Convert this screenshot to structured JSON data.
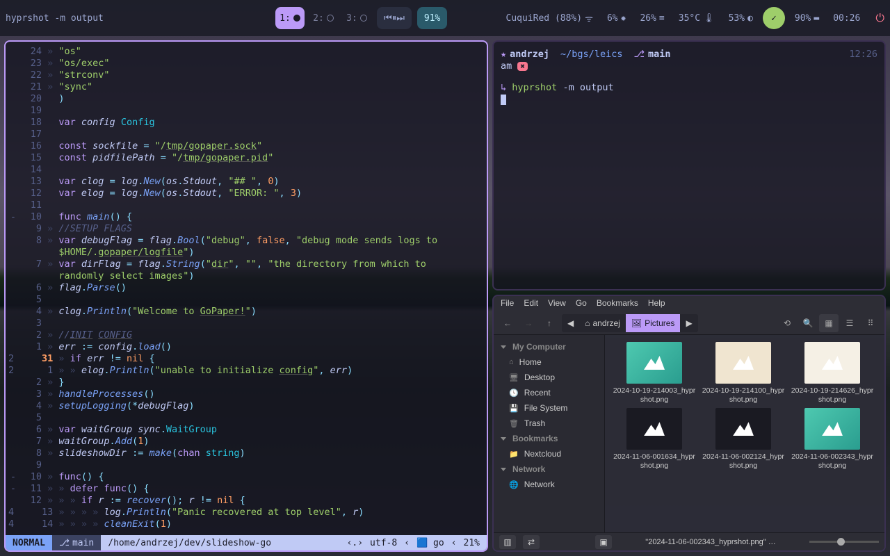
{
  "bar": {
    "command": "hyprshot -m output",
    "workspaces": [
      {
        "label": "1:",
        "active": true
      },
      {
        "label": "2:",
        "active": false
      },
      {
        "label": "3:",
        "active": false
      }
    ],
    "updates_pct": "91%",
    "wifi": "CuquiRed (88%)",
    "cpu": "6%",
    "mem": "26%",
    "temp": "35°C",
    "disk": "53%",
    "battery": "90%",
    "clock": "00:26"
  },
  "editor": {
    "lines": [
      {
        "n": "24",
        "g": "»",
        "html": "<span class='str'>\"os\"</span>"
      },
      {
        "n": "23",
        "g": "»",
        "html": "<span class='str'>\"os/exec\"</span>"
      },
      {
        "n": "22",
        "g": "»",
        "html": "<span class='str'>\"strconv\"</span>"
      },
      {
        "n": "21",
        "g": "»",
        "html": "<span class='str'>\"sync\"</span>"
      },
      {
        "n": "20",
        "g": " ",
        "html": "<span class='punc'>)</span>"
      },
      {
        "n": "19",
        "g": " ",
        "html": ""
      },
      {
        "n": "18",
        "g": " ",
        "html": "<span class='kw'>var</span> <span class='id'>config</span> <span class='typ'>Config</span>"
      },
      {
        "n": "17",
        "g": " ",
        "html": ""
      },
      {
        "n": "16",
        "g": " ",
        "html": "<span class='kw'>const</span> <span class='id'>sockfile</span> <span class='op'>=</span> <span class='str'>\"/<span class='underline'>tmp/gopaper.sock</span>\"</span>"
      },
      {
        "n": "15",
        "g": " ",
        "html": "<span class='kw'>const</span> <span class='id'>pidfilePath</span> <span class='op'>=</span> <span class='str'>\"/<span class='underline'>tmp/gopaper.pid</span>\"</span>"
      },
      {
        "n": "14",
        "g": " ",
        "html": ""
      },
      {
        "n": "13",
        "g": " ",
        "html": "<span class='kw'>var</span> <span class='id'>clog</span> <span class='op'>=</span> <span class='id'>log</span><span class='punc'>.</span><span class='fn'>New</span><span class='punc'>(</span><span class='id'>os</span><span class='punc'>.</span><span class='id'>Stdout</span><span class='punc'>,</span> <span class='str'>\"## \"</span><span class='punc'>,</span> <span class='num'>0</span><span class='punc'>)</span>"
      },
      {
        "n": "12",
        "g": " ",
        "html": "<span class='kw'>var</span> <span class='id'>elog</span> <span class='op'>=</span> <span class='id'>log</span><span class='punc'>.</span><span class='fn'>New</span><span class='punc'>(</span><span class='id'>os</span><span class='punc'>.</span><span class='id'>Stdout</span><span class='punc'>,</span> <span class='str'>\"ERROR: \"</span><span class='punc'>,</span> <span class='num'>3</span><span class='punc'>)</span>"
      },
      {
        "n": "11",
        "g": " ",
        "html": ""
      },
      {
        "n": "10",
        "g": " ",
        "fold": "-",
        "html": "<span class='kw'>func</span> <span class='fn'>main</span><span class='punc'>()</span> <span class='punc'>{</span>"
      },
      {
        "n": "9",
        "g": "»",
        "html": "<span class='com'>//SETUP FLAGS</span>"
      },
      {
        "n": "8",
        "g": "»",
        "html": "<span class='kw'>var</span> <span class='id'>debugFlag</span> <span class='op'>=</span> <span class='id'>flag</span><span class='punc'>.</span><span class='fn'>Bool</span><span class='punc'>(</span><span class='str'>\"debug\"</span><span class='punc'>,</span> <span class='nil'>false</span><span class='punc'>,</span> <span class='str'>\"debug mode sends logs to</span>"
      },
      {
        "n": "",
        "g": " ",
        "html": "<span class='str'>$HOME/.<span class='underline'>gopaper/logfile</span>\"</span><span class='punc'>)</span>"
      },
      {
        "n": "7",
        "g": "»",
        "html": "<span class='kw'>var</span> <span class='id'>dirFlag</span> <span class='op'>=</span> <span class='id'>flag</span><span class='punc'>.</span><span class='fn'>String</span><span class='punc'>(</span><span class='str'>\"<span class='underline'>dir</span>\"</span><span class='punc'>,</span> <span class='str'>\"\"</span><span class='punc'>,</span> <span class='str'>\"the directory from which to</span>"
      },
      {
        "n": "",
        "g": " ",
        "html": "<span class='str'>randomly select images\"</span><span class='punc'>)</span>"
      },
      {
        "n": "6",
        "g": "»",
        "html": "<span class='id'>flag</span><span class='punc'>.</span><span class='fn'>Parse</span><span class='punc'>()</span>"
      },
      {
        "n": "5",
        "g": " ",
        "html": ""
      },
      {
        "n": "4",
        "g": "»",
        "html": "<span class='id'>clog</span><span class='punc'>.</span><span class='fn'>Println</span><span class='punc'>(</span><span class='str'>\"Welcome to <span class='underline'>GoPaper!</span>\"</span><span class='punc'>)</span>"
      },
      {
        "n": "3",
        "g": " ",
        "html": ""
      },
      {
        "n": "2",
        "g": "»",
        "html": "<span class='com'>//<span class='underline'>INIT</span> <span class='underline'>CONFIG</span></span>"
      },
      {
        "n": "1",
        "g": "»",
        "html": "<span class='id'>err</span> <span class='op'>:=</span> <span class='id'>config</span><span class='punc'>.</span><span class='fn'>load</span><span class='punc'>()</span>"
      },
      {
        "n": "31",
        "g": "»",
        "cur": true,
        "html": "<span class='kw'>if</span> <span class='id'>err</span> <span class='op'>!=</span> <span class='nil'>nil</span> <span class='punc'>{</span>",
        "diag": "2"
      },
      {
        "n": "1",
        "g": "»",
        "html": "<span class='guide'>»</span> <span class='id'>elog</span><span class='punc'>.</span><span class='fn'>Println</span><span class='punc'>(</span><span class='str'>\"unable to initialize <span class='underline'>config</span>\"</span><span class='punc'>,</span> <span class='id'>err</span><span class='punc'>)</span>",
        "diag": "2"
      },
      {
        "n": "2",
        "g": "»",
        "html": "<span class='punc'>}</span>"
      },
      {
        "n": "3",
        "g": "»",
        "html": "<span class='fn'>handleProcesses</span><span class='punc'>()</span>"
      },
      {
        "n": "4",
        "g": "»",
        "html": "<span class='fn'>setupLogging</span><span class='punc'>(</span><span class='op'>*</span><span class='id'>debugFlag</span><span class='punc'>)</span>"
      },
      {
        "n": "5",
        "g": " ",
        "html": ""
      },
      {
        "n": "6",
        "g": "»",
        "html": "<span class='kw'>var</span> <span class='id'>waitGroup</span> <span class='id'>sync</span><span class='punc'>.</span><span class='typ'>WaitGroup</span>"
      },
      {
        "n": "7",
        "g": "»",
        "html": "<span class='id'>waitGroup</span><span class='punc'>.</span><span class='fn'>Add</span><span class='punc'>(</span><span class='num'>1</span><span class='punc'>)</span>"
      },
      {
        "n": "8",
        "g": "»",
        "html": "<span class='id'>slideshowDir</span> <span class='op'>:=</span> <span class='fn'>make</span><span class='punc'>(</span><span class='kw'>chan</span> <span class='typ'>string</span><span class='punc'>)</span>"
      },
      {
        "n": "9",
        "g": " ",
        "html": ""
      },
      {
        "n": "10",
        "g": "»",
        "fold": "-",
        "html": "<span class='kw'>func</span><span class='punc'>()</span> <span class='punc'>{</span>"
      },
      {
        "n": "11",
        "g": "»",
        "fold": "-",
        "html": "<span class='guide'>»</span> <span class='kw'>defer</span> <span class='kw'>func</span><span class='punc'>()</span> <span class='punc'>{</span>"
      },
      {
        "n": "12",
        "g": "»",
        "html": "<span class='guide'>» »</span> <span class='kw'>if</span> <span class='id'>r</span> <span class='op'>:=</span> <span class='fn'>recover</span><span class='punc'>();</span> <span class='id'>r</span> <span class='op'>!=</span> <span class='nil'>nil</span> <span class='punc'>{</span>"
      },
      {
        "n": "13",
        "g": "»",
        "html": "<span class='guide'>» » »</span> <span class='id'>log</span><span class='punc'>.</span><span class='fn'>Println</span><span class='punc'>(</span><span class='str'>\"Panic recovered at top level\"</span><span class='punc'>,</span> <span class='id'>r</span><span class='punc'>)</span>",
        "diag": "4"
      },
      {
        "n": "14",
        "g": "»",
        "html": "<span class='guide'>» » »</span> <span class='fn'>cleanExit</span><span class='punc'>(</span><span class='num'>1</span><span class='punc'>)</span>",
        "diag": "4"
      }
    ],
    "status": {
      "mode": "NORMAL",
      "branch": "main",
      "path": "/home/andrzej/dev/slideshow-go",
      "encoding": "utf-8",
      "filetype": "go",
      "percent": "21%"
    }
  },
  "terminal": {
    "user": "andrzej",
    "cwd": "~/bgs/leics",
    "branch": "main",
    "time": "12:26",
    "last_status": "am",
    "cmd": "hyprshot",
    "args": "-m output"
  },
  "fm": {
    "menu": [
      "File",
      "Edit",
      "View",
      "Go",
      "Bookmarks",
      "Help"
    ],
    "path": [
      "andrzej",
      "Pictures"
    ],
    "side": {
      "computer": "My Computer",
      "items": [
        "Home",
        "Desktop",
        "Recent",
        "File System",
        "Trash"
      ],
      "bookmarks_hdr": "Bookmarks",
      "bookmarks": [
        "Nextcloud"
      ],
      "network_hdr": "Network",
      "network": [
        "Network"
      ]
    },
    "files": [
      {
        "name": "2024-10-19-214003_hyprshot.png",
        "cls": "img1"
      },
      {
        "name": "2024-10-19-214100_hyprshot.png",
        "cls": "img2"
      },
      {
        "name": "2024-10-19-214626_hyprshot.png",
        "cls": "img3"
      },
      {
        "name": "2024-11-06-001634_hyprshot.png",
        "cls": "dark"
      },
      {
        "name": "2024-11-06-002124_hyprshot.png",
        "cls": "dark"
      },
      {
        "name": "2024-11-06-002343_hyprshot.png",
        "cls": "img1"
      }
    ],
    "status": "\"2024-11-06-002343_hyprshot.png\" …"
  }
}
